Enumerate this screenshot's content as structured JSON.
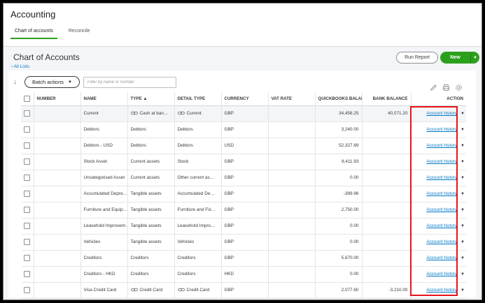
{
  "app": {
    "title": "Accounting"
  },
  "tabs": [
    {
      "label": "Chart of accounts",
      "active": true
    },
    {
      "label": "Reconcile",
      "active": false
    }
  ],
  "page": {
    "title": "Chart of Accounts",
    "back_link": "All Lists"
  },
  "buttons": {
    "run_report": "Run Report",
    "new": "New",
    "batch_actions": "Batch actions"
  },
  "filter": {
    "placeholder": "Filter by name or number",
    "value": ""
  },
  "icons": [
    "pencil-icon",
    "print-icon",
    "gear-icon",
    "sort-icon",
    "chevron-down-icon",
    "bank-link-icon"
  ],
  "colors": {
    "accent": "#2ca01c",
    "link": "#0077c5",
    "highlight": "#e8141c"
  },
  "table": {
    "headers": {
      "number": "NUMBER",
      "name": "NAME",
      "type": "TYPE ▲",
      "detail_type": "DETAIL TYPE",
      "currency": "CURRENCY",
      "vat_rate": "VAT RATE",
      "qb_balance": "QUICKBOOKS BALAI",
      "bank_balance": "BANK BALANCE",
      "action": "ACTION"
    },
    "rows": [
      {
        "number": "",
        "name": "Current",
        "type": "Cash at ban…",
        "type_icon": true,
        "detail": "Current",
        "detail_icon": true,
        "currency": "GBP",
        "vat": "",
        "qb": "34,458.25",
        "bank": "40,071.20",
        "action": "Account history",
        "shaded": true
      },
      {
        "number": "",
        "name": "Debtors",
        "type": "Debtors",
        "type_icon": false,
        "detail": "Debtors",
        "detail_icon": false,
        "currency": "GBP",
        "vat": "",
        "qb": "3,240.00",
        "bank": "",
        "action": "Account history",
        "shaded": false
      },
      {
        "number": "",
        "name": "Debtors - USD",
        "type": "Debtors",
        "type_icon": false,
        "detail": "Debtors",
        "detail_icon": false,
        "currency": "USD",
        "vat": "",
        "qb": "52,327.89",
        "bank": "",
        "action": "Account history",
        "shaded": false
      },
      {
        "number": "",
        "name": "Stock Asset",
        "type": "Current assets",
        "type_icon": false,
        "detail": "Stock",
        "detail_icon": false,
        "currency": "GBP",
        "vat": "",
        "qb": "8,411.93",
        "bank": "",
        "action": "Account history",
        "shaded": false
      },
      {
        "number": "",
        "name": "Uncategorised Asset",
        "type": "Current assets",
        "type_icon": false,
        "detail": "Other current as…",
        "detail_icon": false,
        "currency": "GBP",
        "vat": "",
        "qb": "0.00",
        "bank": "",
        "action": "Account history",
        "shaded": false
      },
      {
        "number": "",
        "name": "Accumulated Depre…",
        "type": "Tangible assets",
        "type_icon": false,
        "detail": "Accumulated De…",
        "detail_icon": false,
        "currency": "GBP",
        "vat": "",
        "qb": "-399.96",
        "bank": "",
        "action": "Account history",
        "shaded": false
      },
      {
        "number": "",
        "name": "Furniture and Equip…",
        "type": "Tangible assets",
        "type_icon": false,
        "detail": "Furniture and Fix…",
        "detail_icon": false,
        "currency": "GBP",
        "vat": "",
        "qb": "2,750.00",
        "bank": "",
        "action": "Account history",
        "shaded": false
      },
      {
        "number": "",
        "name": "Leasehold Improvem…",
        "type": "Tangible assets",
        "type_icon": false,
        "detail": "Leasehold Impro…",
        "detail_icon": false,
        "currency": "GBP",
        "vat": "",
        "qb": "0.00",
        "bank": "",
        "action": "Account history",
        "shaded": false
      },
      {
        "number": "",
        "name": "Vehicles",
        "type": "Tangible assets",
        "type_icon": false,
        "detail": "Vehicles",
        "detail_icon": false,
        "currency": "GBP",
        "vat": "",
        "qb": "0.00",
        "bank": "",
        "action": "Account history",
        "shaded": false
      },
      {
        "number": "",
        "name": "Creditors",
        "type": "Creditors",
        "type_icon": false,
        "detail": "Creditors",
        "detail_icon": false,
        "currency": "GBP",
        "vat": "",
        "qb": "5,670.00",
        "bank": "",
        "action": "Account history",
        "shaded": false
      },
      {
        "number": "",
        "name": "Creditors - HKD",
        "type": "Creditors",
        "type_icon": false,
        "detail": "Creditors",
        "detail_icon": false,
        "currency": "HKD",
        "vat": "",
        "qb": "0.00",
        "bank": "",
        "action": "Account history",
        "shaded": false
      },
      {
        "number": "",
        "name": "Visa Credit Card",
        "type": "Credit Card",
        "type_icon": true,
        "detail": "Credit Card",
        "detail_icon": true,
        "currency": "GBP",
        "vat": "",
        "qb": "2,077.60",
        "bank": "-3,210.00",
        "action": "Account history",
        "shaded": false
      }
    ]
  }
}
